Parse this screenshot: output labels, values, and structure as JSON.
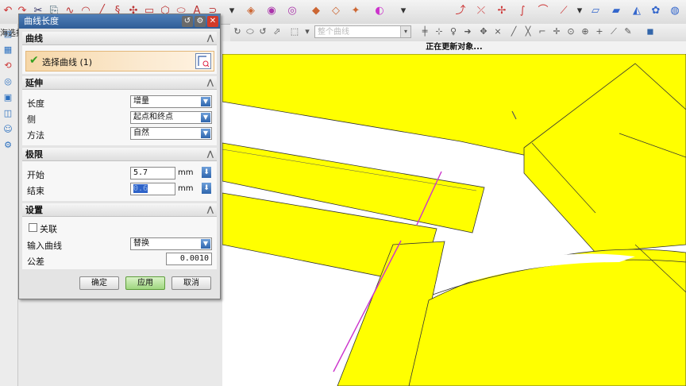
{
  "dialog": {
    "title": "曲线长度",
    "sections": {
      "curve": {
        "title": "曲线",
        "select_label": "选择曲线 (1)"
      },
      "extend": {
        "title": "延伸",
        "length_label": "长度",
        "length_value": "增量",
        "side_label": "侧",
        "side_value": "起点和终点",
        "method_label": "方法",
        "method_value": "自然"
      },
      "limits": {
        "title": "极限",
        "start_label": "开始",
        "start_value": "5.7",
        "start_unit": "mm",
        "end_label": "结束",
        "end_value": "0.6",
        "end_unit": "mm"
      },
      "settings": {
        "title": "设置",
        "associative_label": "关联",
        "input_curve_label": "输入曲线",
        "input_curve_value": "替换",
        "tolerance_label": "公差",
        "tolerance_value": "0.0010"
      }
    },
    "buttons": {
      "ok": "确定",
      "apply": "应用",
      "cancel": "取消"
    }
  },
  "statusbar": {
    "text": "正在更新对象..."
  },
  "toolbar2": {
    "filter_placeholder": "整个曲线"
  },
  "crop_text": "海选择",
  "colors": {
    "surface": "#ffff00",
    "title_bar": "#3d6ca6",
    "accent_line": "#cc33cc"
  }
}
